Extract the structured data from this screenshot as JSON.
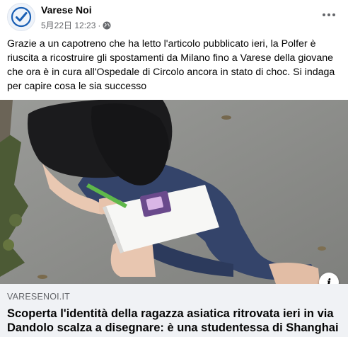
{
  "post": {
    "page_name": "Varese Noi",
    "timestamp": "5月22日 12:23",
    "separator": "·",
    "audience_icon": "globe-icon",
    "text": "Grazie a un capotreno che ha letto l'articolo pubblicato ieri, la Polfer è riuscita a ricostruire gli spostamenti da Milano fino a Varese della giovane che ora è in cura all'Ospedale di Circolo ancora in stato di choc. Si indaga per capire cosa le sia successo"
  },
  "link_preview": {
    "domain": "VARESENOI.IT",
    "headline": "Scoperta l'identità della ragazza asiatica ritrovata ieri in via Dandolo scalza a disegnare: è una studentessa di Shanghai",
    "info_icon": "info-icon",
    "info_glyph": "i"
  },
  "colors": {
    "text": "#050505",
    "secondary_text": "#65676b",
    "card_background": "#f0f2f5",
    "avatar_check": "#1a5fb4"
  }
}
